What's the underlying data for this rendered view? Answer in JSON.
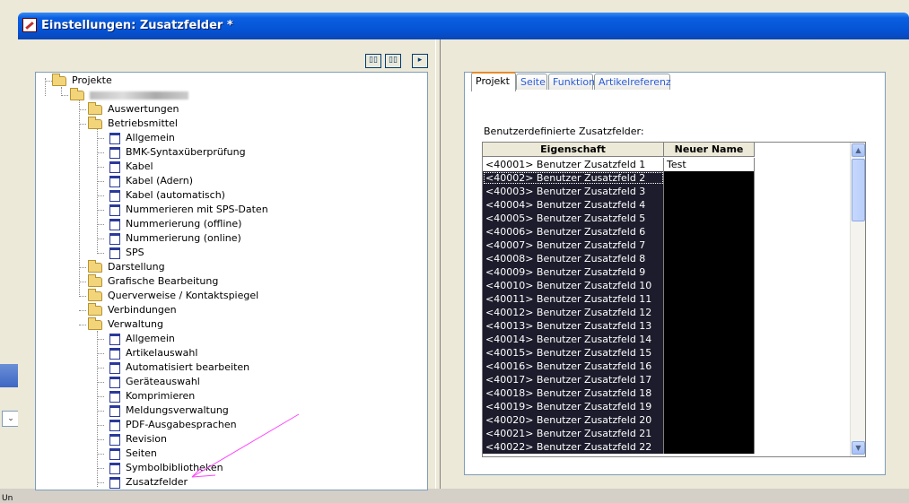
{
  "window": {
    "title": "Einstellungen: Zusatzfelder *"
  },
  "background": {
    "combo_glyph": "⌄",
    "bottom_text": "Un"
  },
  "toolbar": {
    "btn1_glyph": "▯▯",
    "btn2_glyph": "▯▯",
    "btn3_glyph": "▸"
  },
  "tree": {
    "root": "Projekte",
    "project_name_blurred": "",
    "items": [
      "Auswertungen",
      "Betriebsmittel",
      "Allgemein",
      "BMK-Syntaxüberprüfung",
      "Kabel",
      "Kabel (Adern)",
      "Kabel (automatisch)",
      "Nummerieren mit SPS-Daten",
      "Nummerierung (offline)",
      "Nummerierung (online)",
      "SPS",
      "Darstellung",
      "Grafische Bearbeitung",
      "Querverweise / Kontaktspiegel",
      "Verbindungen",
      "Verwaltung",
      "Allgemein",
      "Artikelauswahl",
      "Automatisiert bearbeiten",
      "Geräteauswahl",
      "Komprimieren",
      "Meldungsverwaltung",
      "PDF-Ausgabesprachen",
      "Revision",
      "Seiten",
      "Symbolbibliotheken",
      "Zusatzfelder"
    ]
  },
  "tabs": [
    "Projekt",
    "Seite",
    "Funktion",
    "Artikelreferenz"
  ],
  "group_label": "Benutzerdefinierte Zusatzfelder:",
  "grid": {
    "headers": [
      "Eigenschaft",
      "Neuer Name"
    ],
    "rows": [
      [
        "<40001> Benutzer Zusatzfeld 1",
        "Test"
      ],
      [
        "<40002> Benutzer Zusatzfeld 2",
        ""
      ],
      [
        "<40003> Benutzer Zusatzfeld 3",
        ""
      ],
      [
        "<40004> Benutzer Zusatzfeld 4",
        ""
      ],
      [
        "<40005> Benutzer Zusatzfeld 5",
        ""
      ],
      [
        "<40006> Benutzer Zusatzfeld 6",
        ""
      ],
      [
        "<40007> Benutzer Zusatzfeld 7",
        ""
      ],
      [
        "<40008> Benutzer Zusatzfeld 8",
        ""
      ],
      [
        "<40009> Benutzer Zusatzfeld 9",
        ""
      ],
      [
        "<40010> Benutzer Zusatzfeld 10",
        ""
      ],
      [
        "<40011> Benutzer Zusatzfeld 11",
        ""
      ],
      [
        "<40012> Benutzer Zusatzfeld 12",
        ""
      ],
      [
        "<40013> Benutzer Zusatzfeld 13",
        ""
      ],
      [
        "<40014> Benutzer Zusatzfeld 14",
        ""
      ],
      [
        "<40015> Benutzer Zusatzfeld 15",
        ""
      ],
      [
        "<40016> Benutzer Zusatzfeld 16",
        ""
      ],
      [
        "<40017> Benutzer Zusatzfeld 17",
        ""
      ],
      [
        "<40018> Benutzer Zusatzfeld 18",
        ""
      ],
      [
        "<40019> Benutzer Zusatzfeld 19",
        ""
      ],
      [
        "<40020> Benutzer Zusatzfeld 20",
        ""
      ],
      [
        "<40021> Benutzer Zusatzfeld 21",
        ""
      ],
      [
        "<40022> Benutzer Zusatzfeld 22",
        ""
      ]
    ]
  },
  "colors": {
    "annotation_arrow": "#ff44ff",
    "selection": "#000000",
    "title_bar": "#0552d4"
  }
}
